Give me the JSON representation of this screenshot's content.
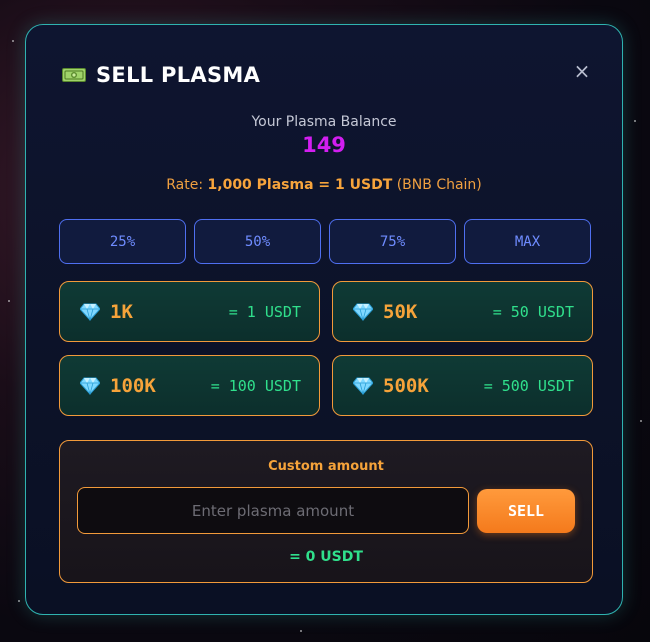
{
  "modal": {
    "title": "SELL PLASMA",
    "close_label": "×",
    "balance_label": "Your Plasma Balance",
    "balance_value": "149",
    "rate": {
      "prefix": "Rate: ",
      "value": "1,000 Plasma = 1 USDT",
      "chain": "(BNB Chain)"
    },
    "percent_buttons": [
      "25%",
      "50%",
      "75%",
      "MAX"
    ],
    "packages": [
      {
        "amount": "1K",
        "usdt": "= 1 USDT"
      },
      {
        "amount": "50K",
        "usdt": "= 50 USDT"
      },
      {
        "amount": "100K",
        "usdt": "= 100 USDT"
      },
      {
        "amount": "500K",
        "usdt": "= 500 USDT"
      }
    ],
    "custom": {
      "label": "Custom amount",
      "placeholder": "Enter plasma amount",
      "sell_label": "SELL",
      "result": "= 0 USDT"
    },
    "icons": {
      "title_icon": "money-icon",
      "package_icon": "gem-icon",
      "close_icon": "close-icon"
    },
    "colors": {
      "accent": "#f29a3a",
      "balance": "#d21ef0",
      "usdt": "#30e08c",
      "border": "#2fb3b0",
      "percent": "#4f6ff0"
    }
  }
}
